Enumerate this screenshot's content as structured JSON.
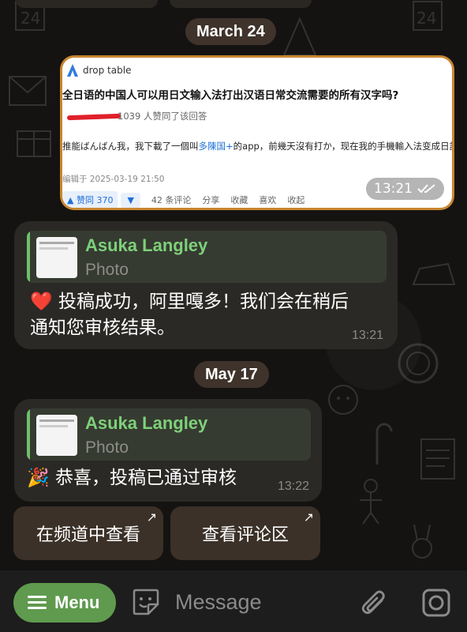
{
  "dates": {
    "first": "March 24",
    "second": "May 17"
  },
  "screenshot_photo": {
    "source": "drop table",
    "title": "全日语的中国人可以用日文输入法打出汉语日常交流需要的所有汉字吗?",
    "approve_text": "1039 人赞同了该回答",
    "body": "推能ばんばん我，我下載了一個叫多陳国+的app，前幾天沒有打か，现在我的手機輸入法变成日語了",
    "body_link": "多陳国+",
    "edited": "编辑于 2025-03-19 21:50",
    "vote_label": "▲ 赞同 370",
    "down_label": "▼",
    "actions": [
      "42 条评论",
      "分享",
      "收藏",
      "喜欢",
      "收起"
    ],
    "time": "13:21"
  },
  "messages": [
    {
      "reply_name": "Asuka Langley",
      "reply_sub": "Photo",
      "emoji": "❤️",
      "text_line1": "投稿成功，阿里嘎多！我们会在稍后",
      "text_line2": "通知您审核结果。",
      "time": "13:21"
    },
    {
      "reply_name": "Asuka Langley",
      "reply_sub": "Photo",
      "emoji": "🎉",
      "text_line1": "恭喜，投稿已通过审核",
      "time": "13:22"
    }
  ],
  "inline_buttons": [
    "在频道中查看",
    "查看评论区"
  ],
  "bottom_bar": {
    "menu_label": "Menu",
    "input_placeholder": "Message"
  },
  "colors": {
    "accent_green": "#5f9a4e",
    "reply_name_green": "#7ed07a",
    "photo_border": "#c8862f"
  }
}
